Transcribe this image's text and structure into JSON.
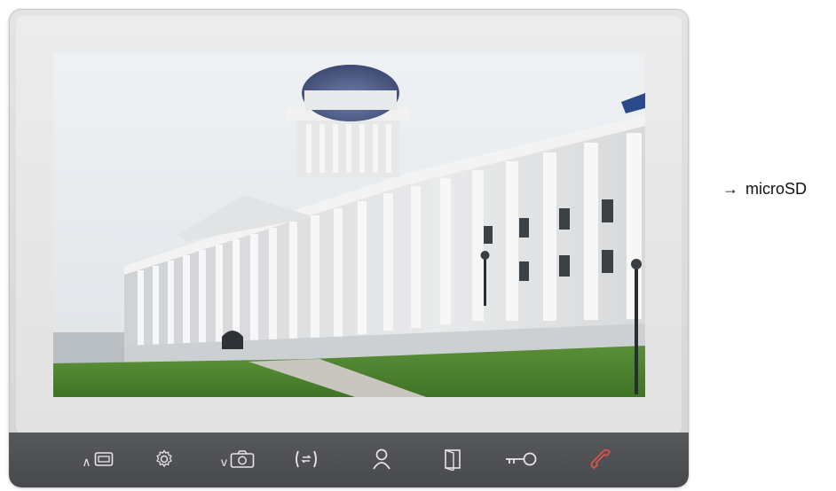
{
  "side_label": {
    "arrow": "→",
    "text": "microSD"
  },
  "controls": [
    {
      "name": "monitor-up-button",
      "icon": "monitor-icon",
      "caret": "∧"
    },
    {
      "name": "settings-button",
      "icon": "gear-icon"
    },
    {
      "name": "snapshot-down-button",
      "icon": "camera-icon",
      "caret": "v"
    },
    {
      "name": "intercom-button",
      "icon": "intercom-icon"
    },
    {
      "name": "contacts-button",
      "icon": "person-icon"
    },
    {
      "name": "door-button",
      "icon": "door-icon"
    },
    {
      "name": "unlock-button",
      "icon": "key-icon"
    },
    {
      "name": "hang-up-button",
      "icon": "handset-icon",
      "color": "#d9534f"
    }
  ],
  "screen": {
    "content": "camera-feed-image"
  }
}
